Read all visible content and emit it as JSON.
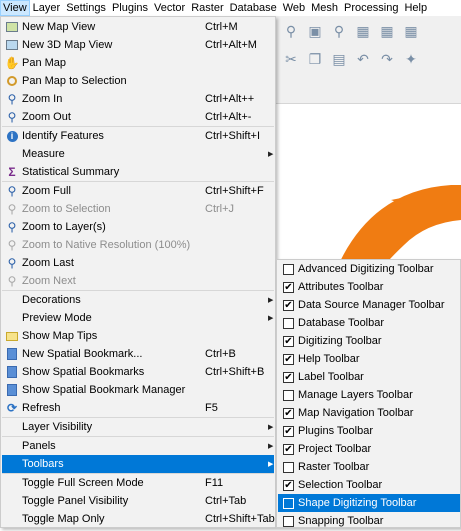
{
  "menubar": {
    "items": [
      {
        "label": "View",
        "active": true
      },
      {
        "label": "Layer"
      },
      {
        "label": "Settings"
      },
      {
        "label": "Plugins"
      },
      {
        "label": "Vector"
      },
      {
        "label": "Raster"
      },
      {
        "label": "Database"
      },
      {
        "label": "Web"
      },
      {
        "label": "Mesh"
      },
      {
        "label": "Processing"
      },
      {
        "label": "Help"
      }
    ]
  },
  "view_menu": {
    "items": [
      {
        "label": "New Map View",
        "shortcut": "Ctrl+M",
        "icon": "map-icon"
      },
      {
        "label": "New 3D Map View",
        "shortcut": "Ctrl+Alt+M",
        "icon": "map-3d-icon"
      },
      {
        "label": "Pan Map",
        "shortcut": "",
        "icon": "hand-icon"
      },
      {
        "label": "Pan Map to Selection",
        "shortcut": "",
        "icon": "pan-selection-icon"
      },
      {
        "label": "Zoom In",
        "shortcut": "Ctrl+Alt++",
        "icon": "zoom-in-icon"
      },
      {
        "label": "Zoom Out",
        "shortcut": "Ctrl+Alt+-",
        "icon": "zoom-out-icon"
      },
      {
        "label": "Identify Features",
        "shortcut": "Ctrl+Shift+I",
        "icon": "identify-icon"
      },
      {
        "label": "Measure",
        "shortcut": "",
        "icon": "",
        "submenu": true
      },
      {
        "label": "Statistical Summary",
        "shortcut": "",
        "icon": "sigma-icon"
      },
      {
        "label": "Zoom Full",
        "shortcut": "Ctrl+Shift+F",
        "icon": "zoom-full-icon"
      },
      {
        "label": "Zoom to Selection",
        "shortcut": "Ctrl+J",
        "icon": "zoom-selection-icon",
        "disabled": true
      },
      {
        "label": "Zoom to Layer(s)",
        "shortcut": "",
        "icon": "zoom-layer-icon"
      },
      {
        "label": "Zoom to Native Resolution (100%)",
        "shortcut": "",
        "icon": "zoom-native-icon",
        "disabled": true
      },
      {
        "label": "Zoom Last",
        "shortcut": "",
        "icon": "zoom-last-icon"
      },
      {
        "label": "Zoom Next",
        "shortcut": "",
        "icon": "zoom-next-icon",
        "disabled": true
      },
      {
        "label": "Decorations",
        "shortcut": "",
        "icon": "",
        "submenu": true
      },
      {
        "label": "Preview Mode",
        "shortcut": "",
        "icon": "",
        "submenu": true
      },
      {
        "label": "Show Map Tips",
        "shortcut": "",
        "icon": "map-tips-icon"
      },
      {
        "label": "New Spatial Bookmark...",
        "shortcut": "Ctrl+B",
        "icon": "bookmark-new-icon"
      },
      {
        "label": "Show Spatial Bookmarks",
        "shortcut": "Ctrl+Shift+B",
        "icon": "bookmarks-icon"
      },
      {
        "label": "Show Spatial Bookmark Manager",
        "shortcut": "",
        "icon": "bookmark-manager-icon"
      },
      {
        "label": "Refresh",
        "shortcut": "F5",
        "icon": "refresh-icon"
      },
      {
        "label": "Layer Visibility",
        "shortcut": "",
        "icon": "",
        "submenu": true
      },
      {
        "label": "Panels",
        "shortcut": "",
        "icon": "",
        "submenu": true
      },
      {
        "label": "Toolbars",
        "shortcut": "",
        "icon": "",
        "submenu": true,
        "highlighted": true
      },
      {
        "label": "Toggle Full Screen Mode",
        "shortcut": "F11",
        "icon": ""
      },
      {
        "label": "Toggle Panel Visibility",
        "shortcut": "Ctrl+Tab",
        "icon": ""
      },
      {
        "label": "Toggle Map Only",
        "shortcut": "Ctrl+Shift+Tab",
        "icon": ""
      }
    ]
  },
  "toolbars_menu": {
    "items": [
      {
        "label": "Advanced Digitizing Toolbar",
        "checked": false
      },
      {
        "label": "Attributes Toolbar",
        "checked": true
      },
      {
        "label": "Data Source Manager Toolbar",
        "checked": true
      },
      {
        "label": "Database Toolbar",
        "checked": false
      },
      {
        "label": "Digitizing Toolbar",
        "checked": true
      },
      {
        "label": "Help Toolbar",
        "checked": true
      },
      {
        "label": "Label Toolbar",
        "checked": true
      },
      {
        "label": "Manage Layers Toolbar",
        "checked": false
      },
      {
        "label": "Map Navigation Toolbar",
        "checked": true
      },
      {
        "label": "Plugins Toolbar",
        "checked": true
      },
      {
        "label": "Project Toolbar",
        "checked": true
      },
      {
        "label": "Raster Toolbar",
        "checked": false
      },
      {
        "label": "Selection Toolbar",
        "checked": true
      },
      {
        "label": "Shape Digitizing Toolbar",
        "checked": false,
        "highlighted": true
      },
      {
        "label": "Snapping Toolbar",
        "checked": false
      }
    ]
  },
  "colors": {
    "highlight": "#0078d7",
    "menubar_active": "#cce8ff",
    "map_feature": "#f07c12"
  }
}
